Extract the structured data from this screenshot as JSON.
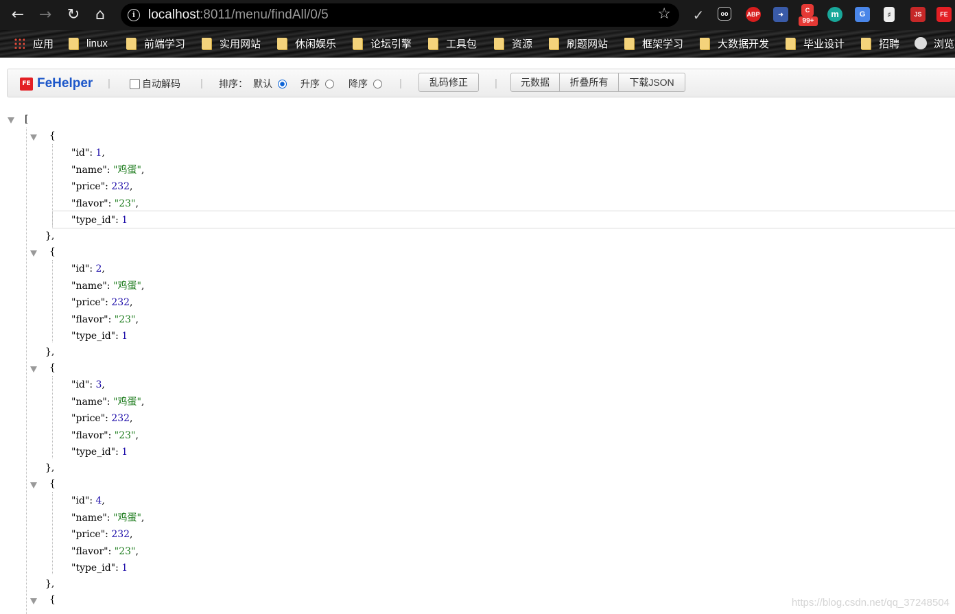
{
  "browser": {
    "url_host": "localhost",
    "url_path": ":8011/menu/findAll/0/5",
    "extensions": [
      {
        "label": "ABP",
        "color": "#d81e1e"
      },
      {
        "label": "99+",
        "color": "#e53935"
      },
      {
        "label": "m",
        "color": "#19a89a"
      },
      {
        "label": "G",
        "color": "#4a86e8"
      },
      {
        "label": "JS",
        "color": "#c62828"
      },
      {
        "label": "FE",
        "color": "#e31f24"
      }
    ]
  },
  "bookmarks": [
    "应用",
    "linux",
    "前端学习",
    "实用网站",
    "休闲娱乐",
    "论坛引擎",
    "工具包",
    "资源",
    "刷题网站",
    "框架学习",
    "大数据开发",
    "毕业设计",
    "招聘",
    "浏览"
  ],
  "fehelper": {
    "logo": "FeHelper",
    "logo_icon": "FE",
    "auto_decode": "自动解码",
    "sort_label": "排序：",
    "sort_default": "默认",
    "sort_asc": "升序",
    "sort_desc": "降序",
    "fix_encoding": "乱码修正",
    "metadata": "元数据",
    "collapse_all": "折叠所有",
    "download_json": "下载JSON"
  },
  "json": {
    "open_bracket": "[",
    "items": [
      {
        "id": "1",
        "name": "鸡蛋",
        "price": "232",
        "flavor": "23",
        "type_id": "1"
      },
      {
        "id": "2",
        "name": "鸡蛋",
        "price": "232",
        "flavor": "23",
        "type_id": "1"
      },
      {
        "id": "3",
        "name": "鸡蛋",
        "price": "232",
        "flavor": "23",
        "type_id": "1"
      },
      {
        "id": "4",
        "name": "鸡蛋",
        "price": "232",
        "flavor": "23",
        "type_id": "1"
      }
    ],
    "partial_open": "{"
  },
  "watermark": "https://blog.csdn.net/qq_37248504"
}
